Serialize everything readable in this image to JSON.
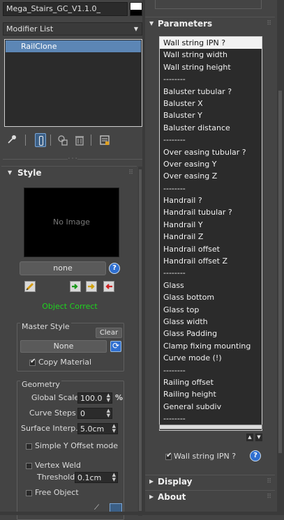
{
  "object": {
    "name": "Mega_Stairs_GC_V1.1.0_"
  },
  "modifier": {
    "list_label": "Modifier List",
    "stack": [
      "RailClone"
    ]
  },
  "style": {
    "header": "Style",
    "preview_text": "No Image",
    "style_value": "none",
    "status": "Object Correct",
    "status_color": "#1ed31e"
  },
  "master_style": {
    "label": "Master Style",
    "clear": "Clear",
    "value": "None",
    "copy_material": "Copy Material",
    "copy_material_checked": true
  },
  "geometry": {
    "label": "Geometry",
    "global_scale_label": "Global Scale",
    "global_scale_value": "100.0",
    "global_scale_unit": "%",
    "curve_steps_label": "Curve Steps",
    "curve_steps_value": "0",
    "surface_interp_label": "Surface Interp.",
    "surface_interp_value": "5.0cm",
    "simple_y_offset": "Simple Y Offset mode",
    "vertex_weld": "Vertex Weld",
    "threshold_label": "Threshold",
    "threshold_value": "0.1cm",
    "free_object": "Free Object"
  },
  "parameters": {
    "header": "Parameters",
    "items": [
      "Wall string IPN ?",
      "Wall string width",
      "Wall string height",
      "--------",
      "Baluster tubular ?",
      "Baluster X",
      "Baluster Y",
      "Baluster distance",
      "--------",
      "Over easing tubular ?",
      "Over easing Y",
      "Over easing Z",
      "--------",
      "Handrail ?",
      "Handrail tubular ?",
      "Handrail Y",
      "Handrail Z",
      "Handrail offset",
      "Handrail offset Z",
      "--------",
      "Glass",
      "Glass bottom",
      "Glass top",
      "Glass width",
      "Glass Padding",
      "Clamp fixing mounting",
      "Curve mode (!)",
      "--------",
      "Railing offset",
      "Railing height",
      "General subdiv",
      "--------"
    ],
    "selected_label": "Wall string IPN ?",
    "selected_checked": true
  },
  "rollouts": {
    "display": "Display",
    "about": "About"
  }
}
